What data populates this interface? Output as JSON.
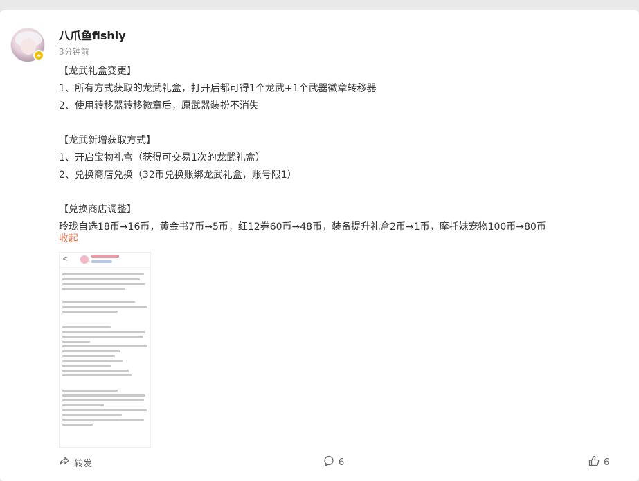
{
  "post": {
    "author": "八爪鱼fishly",
    "time": "3分钟前",
    "lines": [
      "【龙武礼盒变更】",
      "1、所有方式获取的龙武礼盒，打开后都可得1个龙武+1个武器徽章转移器",
      "2、使用转移器转移徽章后，原武器装扮不消失",
      "",
      "【龙武新增获取方式】",
      "1、开启宝物礼盒（获得可交易1次的龙武礼盒）",
      "2、兑换商店兑换（32币兑换账绑龙武礼盒，账号限1）",
      "",
      "【兑换商店调整】",
      "玲珑自选18币→16币，黄金书7币→5币，红12券60币→48币，装备提升礼盒2币→1币，摩托妹宠物100币→80币"
    ],
    "collapse_label": "收起"
  },
  "actions": {
    "repost_label": "转发",
    "comment_count": "6",
    "like_count": "6"
  },
  "icons": {
    "badge": "lightning-badge-icon",
    "repost": "repost-icon",
    "comment": "comment-icon",
    "like": "like-icon"
  }
}
